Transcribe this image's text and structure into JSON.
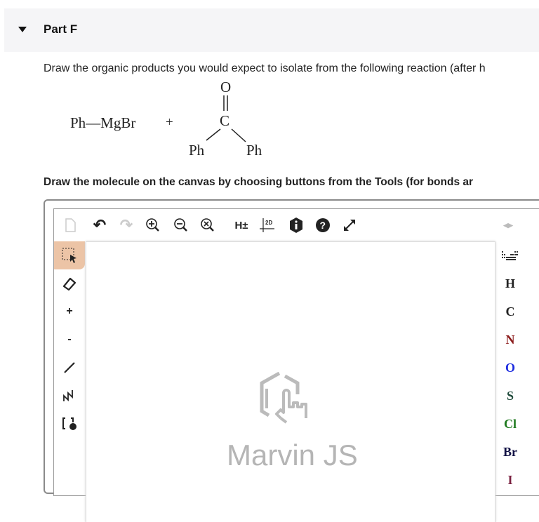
{
  "section": {
    "title": "Part F"
  },
  "question": "Draw the organic products you would expect to isolate from the following reaction (after h",
  "reaction": {
    "reagent1": "Ph—MgBr",
    "plus": "+",
    "carbonyl_o": "O",
    "carbonyl_c": "C",
    "sub_left": "Ph",
    "sub_right": "Ph"
  },
  "instruction": "Draw the molecule on the canvas by choosing buttons from the Tools (for bonds ar",
  "editor": {
    "toolbar": [
      "new-document",
      "undo",
      "redo",
      "zoom-in",
      "zoom-out",
      "zoom-reset",
      "H±",
      "2D",
      "info",
      "help",
      "fullscreen"
    ],
    "h_toggle": "H±",
    "clean2d": "2D",
    "left_tools": [
      "select",
      "erase",
      "+",
      "-",
      "single-bond",
      "chain",
      "bracket"
    ],
    "plus": "+",
    "minus": "-",
    "elements": [
      {
        "s": "H",
        "c": "#222222"
      },
      {
        "s": "C",
        "c": "#222222"
      },
      {
        "s": "N",
        "c": "#8b1a1a"
      },
      {
        "s": "O",
        "c": "#1f2ee0"
      },
      {
        "s": "S",
        "c": "#1f4a3a"
      },
      {
        "s": "Cl",
        "c": "#1f7a1f"
      },
      {
        "s": "Br",
        "c": "#111144"
      },
      {
        "s": "I",
        "c": "#7a2040"
      }
    ],
    "watermark": "Marvin JS"
  }
}
